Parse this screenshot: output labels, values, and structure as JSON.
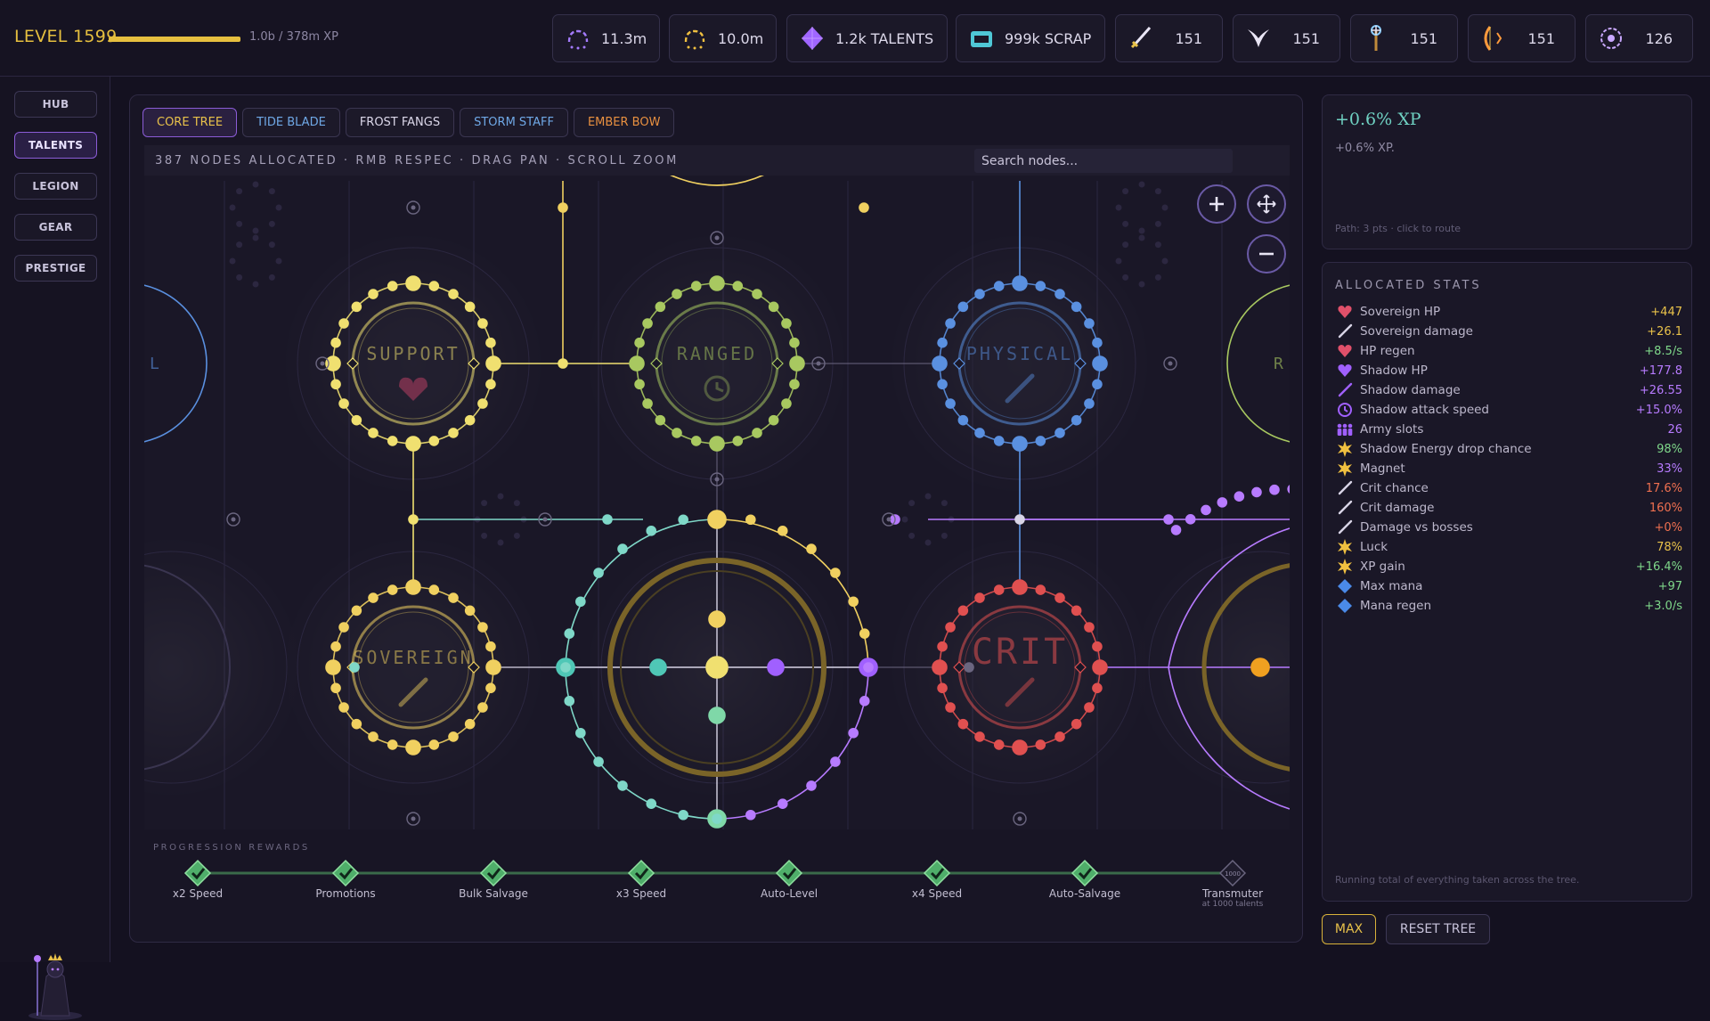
{
  "top": {
    "level": "LEVEL 1599",
    "xp_progress": 1.0,
    "xp_text": "1.0b / 378m XP",
    "resources": [
      {
        "icon": "dome-purple-icon",
        "value": "11.3m",
        "color": "#a47bff"
      },
      {
        "icon": "dome-gold-icon",
        "value": "10.0m",
        "color": "#f0c040"
      },
      {
        "icon": "talent-gem-icon",
        "value": "1.2k TALENTS",
        "color": "#a066ff"
      },
      {
        "icon": "scrap-chest-icon",
        "value": "999k SCRAP",
        "color": "#4fc7d6"
      },
      {
        "icon": "sword-icon",
        "value": "151",
        "color": "#e9e5f5"
      },
      {
        "icon": "fangs-icon",
        "value": "151",
        "color": "#e9e5f5"
      },
      {
        "icon": "staff-icon",
        "value": "151",
        "color": "#f0c040"
      },
      {
        "icon": "bow-icon",
        "value": "151",
        "color": "#ff9a3c"
      },
      {
        "icon": "eye-icon",
        "value": "126",
        "color": "#c9a8ff"
      }
    ]
  },
  "nav": [
    "HUB",
    "TALENTS",
    "LEGION",
    "GEAR",
    "PRESTIGE"
  ],
  "nav_active": "TALENTS",
  "tabs": [
    {
      "label": "CORE TREE",
      "color": "#e9c24a",
      "active": true
    },
    {
      "label": "TIDE BLADE",
      "color": "#6fa8e6"
    },
    {
      "label": "FROST FANGS",
      "color": "#dcd8ea"
    },
    {
      "label": "STORM STAFF",
      "color": "#6fa8e6"
    },
    {
      "label": "EMBER BOW",
      "color": "#e89040"
    }
  ],
  "tree": {
    "info": "387 NODES ALLOCATED · RMB RESPEC · DRAG PAN · SCROLL ZOOM",
    "search_placeholder": "Search nodes...",
    "hubs": [
      {
        "label": "SUPPORT",
        "color": "#f0e070"
      },
      {
        "label": "RANGED",
        "color": "#a8c860"
      },
      {
        "label": "PHYSICAL",
        "color": "#5a90e0"
      },
      {
        "label": "SOVEREIGN",
        "color": "#f0d060"
      },
      {
        "label": "CRIT",
        "color": "#e05050"
      }
    ],
    "edge_labels": [
      "L",
      "R"
    ]
  },
  "progression": {
    "title": "PROGRESSION REWARDS",
    "milestones": [
      {
        "label": "x2 Speed",
        "done": true
      },
      {
        "label": "Promotions",
        "done": true
      },
      {
        "label": "Bulk Salvage",
        "done": true
      },
      {
        "label": "x3 Speed",
        "done": true
      },
      {
        "label": "Auto-Level",
        "done": true
      },
      {
        "label": "x4 Speed",
        "done": true
      },
      {
        "label": "Auto-Salvage",
        "done": true
      },
      {
        "label": "Transmuter",
        "sub": "at 1000 talents",
        "badge": "1000",
        "done": false
      }
    ]
  },
  "detail": {
    "title": "+0.6% XP",
    "desc": "+0.6% XP.",
    "path": "Path: 3 pts · click to route"
  },
  "stats": {
    "title": "ALLOCATED STATS",
    "rows": [
      {
        "icon": "heart-icon",
        "name": "Sovereign HP",
        "value": "+447",
        "icolor": "#e0506a",
        "vcolor": "#e9c24a"
      },
      {
        "icon": "sword-icon",
        "name": "Sovereign damage",
        "value": "+26.1",
        "icolor": "#d8d4e6",
        "vcolor": "#e9c24a"
      },
      {
        "icon": "heart-icon",
        "name": "HP regen",
        "value": "+8.5/s",
        "icolor": "#e0506a",
        "vcolor": "#7fd88a"
      },
      {
        "icon": "heart-icon",
        "name": "Shadow HP",
        "value": "+177.8",
        "icolor": "#a060ff",
        "vcolor": "#b77bff"
      },
      {
        "icon": "sword-icon",
        "name": "Shadow damage",
        "value": "+26.55",
        "icolor": "#a060ff",
        "vcolor": "#b77bff"
      },
      {
        "icon": "clock-icon",
        "name": "Shadow attack speed",
        "value": "+15.0%",
        "icolor": "#a060ff",
        "vcolor": "#b77bff"
      },
      {
        "icon": "army-icon",
        "name": "Army slots",
        "value": "26",
        "icolor": "#a060ff",
        "vcolor": "#b77bff"
      },
      {
        "icon": "star-icon",
        "name": "Shadow Energy drop chance",
        "value": "98%",
        "icolor": "#f0c040",
        "vcolor": "#7fd88a"
      },
      {
        "icon": "star-icon",
        "name": "Magnet",
        "value": "33%",
        "icolor": "#f0c040",
        "vcolor": "#b77bff"
      },
      {
        "icon": "sword-icon",
        "name": "Crit chance",
        "value": "17.6%",
        "icolor": "#d8d4e6",
        "vcolor": "#f07050"
      },
      {
        "icon": "sword-icon",
        "name": "Crit damage",
        "value": "160%",
        "icolor": "#d8d4e6",
        "vcolor": "#f07050"
      },
      {
        "icon": "sword-icon",
        "name": "Damage vs bosses",
        "value": "+0%",
        "icolor": "#d8d4e6",
        "vcolor": "#f07050"
      },
      {
        "icon": "star-icon",
        "name": "Luck",
        "value": "78%",
        "icolor": "#f0c040",
        "vcolor": "#e9c24a"
      },
      {
        "icon": "star-icon",
        "name": "XP gain",
        "value": "+16.4%",
        "icolor": "#f0c040",
        "vcolor": "#7fd88a"
      },
      {
        "icon": "diamond-icon",
        "name": "Max mana",
        "value": "+97",
        "icolor": "#4a8ae8",
        "vcolor": "#7fd88a"
      },
      {
        "icon": "diamond-icon",
        "name": "Mana regen",
        "value": "+3.0/s",
        "icolor": "#4a8ae8",
        "vcolor": "#7fd88a"
      }
    ],
    "footer": "Running total of everything taken across the tree."
  },
  "buttons": {
    "max": "MAX",
    "reset": "RESET TREE"
  }
}
